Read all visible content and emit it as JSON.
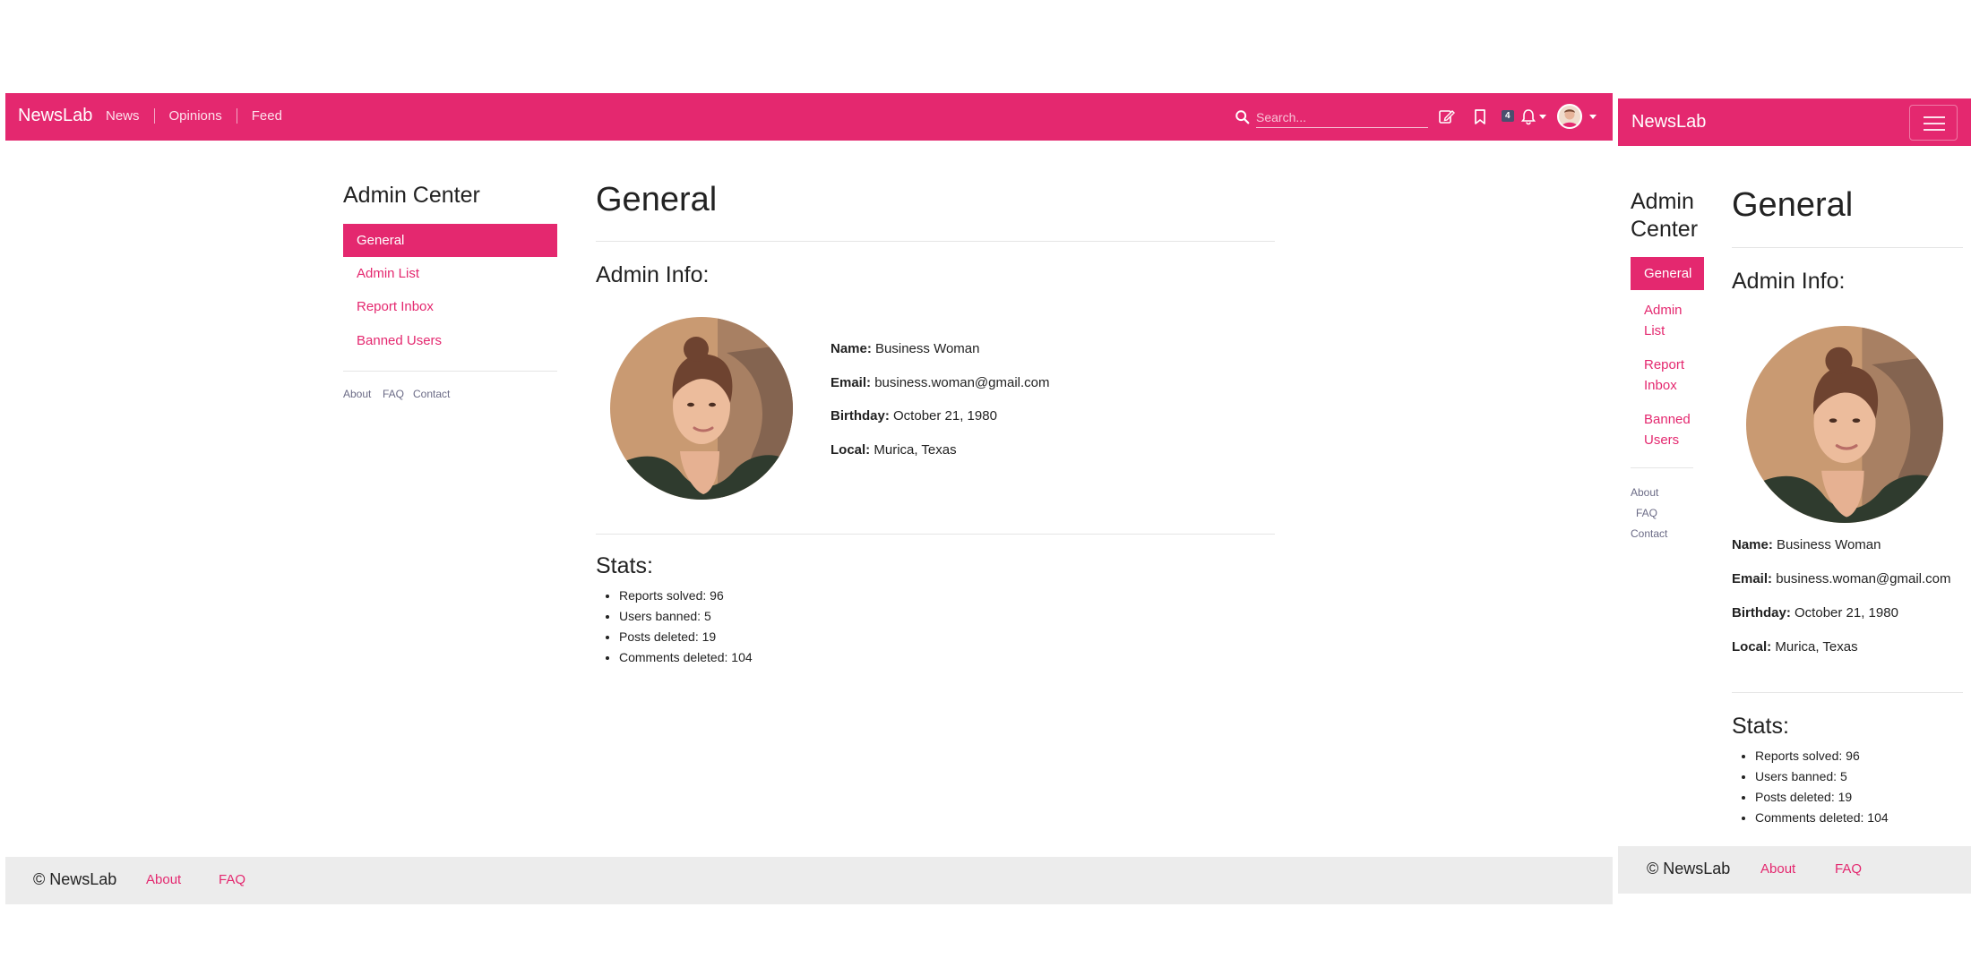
{
  "brand": "NewsLab",
  "nav": {
    "links": [
      "News",
      "Opinions",
      "Feed"
    ],
    "search_placeholder": "Search...",
    "notification_count": "4"
  },
  "sidebar": {
    "title": "Admin Center",
    "items": [
      {
        "label": "General",
        "active": true
      },
      {
        "label": "Admin List",
        "active": false
      },
      {
        "label": "Report Inbox",
        "active": false
      },
      {
        "label": "Banned Users",
        "active": false
      }
    ],
    "footer_links": [
      "About",
      "FAQ",
      "Contact"
    ]
  },
  "main": {
    "title": "General",
    "admin_info_heading": "Admin Info:",
    "info": [
      {
        "label": "Name:",
        "value": "Business Woman"
      },
      {
        "label": "Email:",
        "value": "business.woman@gmail.com"
      },
      {
        "label": "Birthday:",
        "value": "October 21, 1980"
      },
      {
        "label": "Local:",
        "value": "Murica, Texas"
      }
    ],
    "stats_heading": "Stats:",
    "stats": [
      "Reports solved: 96",
      "Users banned: 5",
      "Posts deleted: 19",
      "Comments deleted: 104"
    ]
  },
  "footer": {
    "copyright": "© NewsLab",
    "links": [
      "About",
      "FAQ"
    ]
  },
  "mobile": {
    "sidebar_title_line1": "Admin",
    "sidebar_title_line2": "Center",
    "items": [
      {
        "line1": "General",
        "line2": ""
      },
      {
        "line1": "Admin",
        "line2": "List"
      },
      {
        "line1": "Report",
        "line2": "Inbox"
      },
      {
        "line1": "Banned",
        "line2": "Users"
      }
    ]
  },
  "colors": {
    "accent": "#e4286f",
    "footer_bg": "#ececec",
    "badge_bg": "#4a4f6e"
  }
}
